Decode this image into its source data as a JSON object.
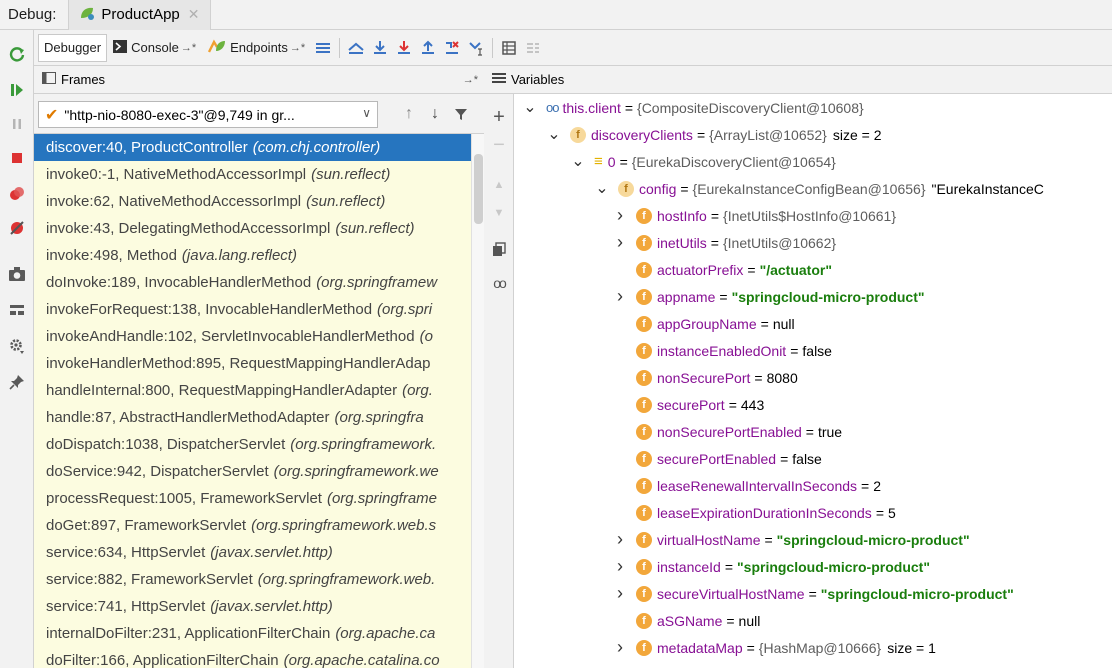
{
  "title_bar": {
    "label": "Debug:",
    "tab": "ProductApp"
  },
  "tabs": [
    {
      "label": "Debugger"
    },
    {
      "label": "Console"
    },
    {
      "label": "Endpoints"
    }
  ],
  "frames": {
    "header": "Frames",
    "thread": "\"http-nio-8080-exec-3\"@9,749 in gr...",
    "items": [
      {
        "method": "discover:40, ProductController",
        "cls": "(com.chj.controller)"
      },
      {
        "method": "invoke0:-1, NativeMethodAccessorImpl",
        "cls": "(sun.reflect)"
      },
      {
        "method": "invoke:62, NativeMethodAccessorImpl",
        "cls": "(sun.reflect)"
      },
      {
        "method": "invoke:43, DelegatingMethodAccessorImpl",
        "cls": "(sun.reflect)"
      },
      {
        "method": "invoke:498, Method",
        "cls": "(java.lang.reflect)"
      },
      {
        "method": "doInvoke:189, InvocableHandlerMethod",
        "cls": "(org.springframew"
      },
      {
        "method": "invokeForRequest:138, InvocableHandlerMethod",
        "cls": "(org.spri"
      },
      {
        "method": "invokeAndHandle:102, ServletInvocableHandlerMethod",
        "cls": "(o"
      },
      {
        "method": "invokeHandlerMethod:895, RequestMappingHandlerAdap",
        "cls": ""
      },
      {
        "method": "handleInternal:800, RequestMappingHandlerAdapter",
        "cls": "(org."
      },
      {
        "method": "handle:87, AbstractHandlerMethodAdapter",
        "cls": "(org.springfra"
      },
      {
        "method": "doDispatch:1038, DispatcherServlet",
        "cls": "(org.springframework."
      },
      {
        "method": "doService:942, DispatcherServlet",
        "cls": "(org.springframework.we"
      },
      {
        "method": "processRequest:1005, FrameworkServlet",
        "cls": "(org.springframe"
      },
      {
        "method": "doGet:897, FrameworkServlet",
        "cls": "(org.springframework.web.s"
      },
      {
        "method": "service:634, HttpServlet",
        "cls": "(javax.servlet.http)"
      },
      {
        "method": "service:882, FrameworkServlet",
        "cls": "(org.springframework.web."
      },
      {
        "method": "service:741, HttpServlet",
        "cls": "(javax.servlet.http)"
      },
      {
        "method": "internalDoFilter:231, ApplicationFilterChain",
        "cls": "(org.apache.ca"
      },
      {
        "method": "doFilter:166, ApplicationFilterChain",
        "cls": "(org.apache.catalina.co"
      }
    ]
  },
  "variables": {
    "header": "Variables",
    "items": [
      {
        "arrow": "down",
        "icon": "oo",
        "name": "this.client",
        "obj": "{CompositeDiscoveryClient@10608}",
        "str": "",
        "extra": ""
      },
      {
        "arrow": "down",
        "icon": "f-dim",
        "name": "discoveryClients",
        "obj": "{ArrayList@10652}",
        "str": "",
        "extra": "size = 2"
      },
      {
        "arrow": "down",
        "icon": "bars",
        "name": "0",
        "obj": "{EurekaDiscoveryClient@10654}",
        "str": "",
        "extra": ""
      },
      {
        "arrow": "down",
        "icon": "f-dim",
        "name": "config",
        "obj": "{EurekaInstanceConfigBean@10656}",
        "str": "",
        "extra": "\"EurekaInstanceC"
      },
      {
        "arrow": "right",
        "icon": "f",
        "name": "hostInfo",
        "obj": "{InetUtils$HostInfo@10661}",
        "str": "",
        "extra": ""
      },
      {
        "arrow": "right",
        "icon": "f",
        "name": "inetUtils",
        "obj": "{InetUtils@10662}",
        "str": "",
        "extra": ""
      },
      {
        "arrow": "",
        "icon": "f",
        "name": "actuatorPrefix",
        "obj": "",
        "str": "\"/actuator\"",
        "extra": ""
      },
      {
        "arrow": "right",
        "icon": "f",
        "name": "appname",
        "obj": "",
        "str": "\"springcloud-micro-product\"",
        "extra": ""
      },
      {
        "arrow": "",
        "icon": "f",
        "name": "appGroupName",
        "obj": "",
        "str": "",
        "extra": "null"
      },
      {
        "arrow": "",
        "icon": "f",
        "name": "instanceEnabledOnit",
        "obj": "",
        "str": "",
        "extra": "false"
      },
      {
        "arrow": "",
        "icon": "f",
        "name": "nonSecurePort",
        "obj": "",
        "str": "",
        "extra": "8080"
      },
      {
        "arrow": "",
        "icon": "f",
        "name": "securePort",
        "obj": "",
        "str": "",
        "extra": "443"
      },
      {
        "arrow": "",
        "icon": "f",
        "name": "nonSecurePortEnabled",
        "obj": "",
        "str": "",
        "extra": "true"
      },
      {
        "arrow": "",
        "icon": "f",
        "name": "securePortEnabled",
        "obj": "",
        "str": "",
        "extra": "false"
      },
      {
        "arrow": "",
        "icon": "f",
        "name": "leaseRenewalIntervalInSeconds",
        "obj": "",
        "str": "",
        "extra": "2"
      },
      {
        "arrow": "",
        "icon": "f",
        "name": "leaseExpirationDurationInSeconds",
        "obj": "",
        "str": "",
        "extra": "5"
      },
      {
        "arrow": "right",
        "icon": "f",
        "name": "virtualHostName",
        "obj": "",
        "str": "\"springcloud-micro-product\"",
        "extra": ""
      },
      {
        "arrow": "right",
        "icon": "f",
        "name": "instanceId",
        "obj": "",
        "str": "\"springcloud-micro-product\"",
        "extra": ""
      },
      {
        "arrow": "right",
        "icon": "f",
        "name": "secureVirtualHostName",
        "obj": "",
        "str": "\"springcloud-micro-product\"",
        "extra": ""
      },
      {
        "arrow": "",
        "icon": "f",
        "name": "aSGName",
        "obj": "",
        "str": "",
        "extra": "null"
      },
      {
        "arrow": "right",
        "icon": "f",
        "name": "metadataMap",
        "obj": "{HashMap@10666}",
        "str": "",
        "extra": "size = 1"
      }
    ]
  }
}
